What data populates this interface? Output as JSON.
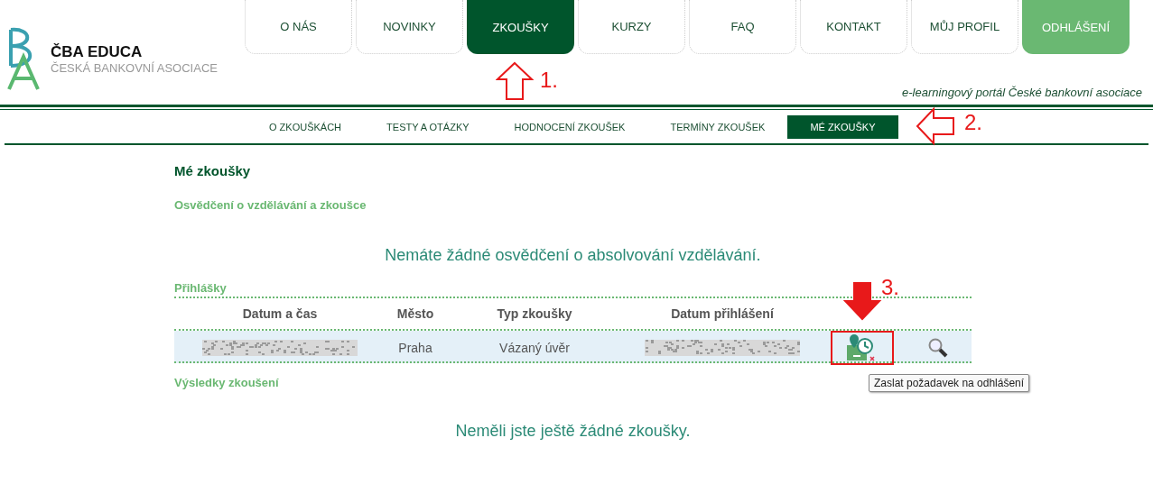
{
  "logo": {
    "title": "ČBA EDUCA",
    "subtitle": "ČESKÁ BANKOVNÍ ASOCIACE"
  },
  "main_nav": [
    {
      "label": "O NÁS",
      "selected": false,
      "kind": "tab"
    },
    {
      "label": "NOVINKY",
      "selected": false,
      "kind": "tab"
    },
    {
      "label": "ZKOUŠKY",
      "selected": true,
      "kind": "tab"
    },
    {
      "label": "KURZY",
      "selected": false,
      "kind": "tab"
    },
    {
      "label": "FAQ",
      "selected": false,
      "kind": "tab"
    },
    {
      "label": "KONTAKT",
      "selected": false,
      "kind": "tab"
    },
    {
      "label": "MŮJ PROFIL",
      "selected": false,
      "kind": "tab"
    },
    {
      "label": "ODHLÁŠENÍ",
      "selected": false,
      "kind": "logout"
    }
  ],
  "tagline": "e-learningový portál České bankovní asociace",
  "sub_nav": [
    {
      "label": "O ZKOUŠKÁCH",
      "selected": false
    },
    {
      "label": "TESTY A OTÁZKY",
      "selected": false
    },
    {
      "label": "HODNOCENÍ ZKOUŠEK",
      "selected": false
    },
    {
      "label": "TERMÍNY ZKOUŠEK",
      "selected": false
    },
    {
      "label": "MÉ ZKOUŠKY",
      "selected": true
    }
  ],
  "page_title": "Mé zkoušky",
  "certificates": {
    "title": "Osvědčení o vzdělávání a zkoušce",
    "empty_message": "Nemáte žádné osvědčení o absolvování vzdělávání."
  },
  "applications": {
    "title": "Přihlášky",
    "columns": [
      "Datum a čas",
      "Město",
      "Typ zkoušky",
      "Datum přihlášení"
    ],
    "rows": [
      {
        "cells": [
          {
            "kind": "redacted"
          },
          {
            "kind": "text",
            "text": "Praha"
          },
          {
            "kind": "text",
            "text": "Vázaný úvěr"
          },
          {
            "kind": "redacted"
          }
        ],
        "highlighted": true,
        "tooltip": "Zaslat požadavek na odhlášení"
      }
    ]
  },
  "results": {
    "title": "Výsledky zkoušení",
    "empty_message": "Neměli jste ještě žádné zkoušky."
  },
  "annotations": [
    {
      "label": "1.",
      "kind": "up"
    },
    {
      "label": "2.",
      "kind": "left"
    },
    {
      "label": "3.",
      "kind": "down"
    }
  ]
}
